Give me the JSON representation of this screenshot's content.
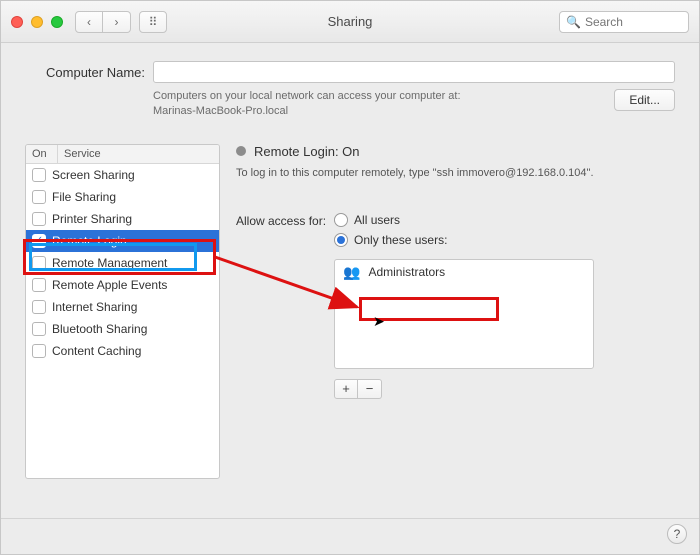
{
  "window": {
    "title": "Sharing"
  },
  "search": {
    "placeholder": "Search"
  },
  "computer_name": {
    "label": "Computer Name:",
    "value": "",
    "info_line1": "Computers on your local network can access your computer at:",
    "info_line2": "Marinas-MacBook-Pro.local",
    "edit_label": "Edit..."
  },
  "services": {
    "col_on": "On",
    "col_service": "Service",
    "items": [
      {
        "label": "Screen Sharing",
        "on": false
      },
      {
        "label": "File Sharing",
        "on": false
      },
      {
        "label": "Printer Sharing",
        "on": false
      },
      {
        "label": "Remote Login",
        "on": true
      },
      {
        "label": "Remote Management",
        "on": false
      },
      {
        "label": "Remote Apple Events",
        "on": false
      },
      {
        "label": "Internet Sharing",
        "on": false
      },
      {
        "label": "Bluetooth Sharing",
        "on": false
      },
      {
        "label": "Content Caching",
        "on": false
      }
    ],
    "selected_index": 3
  },
  "detail": {
    "status_label": "Remote Login: On",
    "status_hint": "To log in to this computer remotely, type \"ssh immovero@192.168.0.104\".",
    "allow_label": "Allow access for:",
    "radio_all": "All users",
    "radio_only": "Only these users:",
    "selected_radio": "only",
    "users": [
      {
        "label": "Administrators"
      }
    ],
    "add_label": "+",
    "remove_label": "−"
  },
  "help_label": "?"
}
